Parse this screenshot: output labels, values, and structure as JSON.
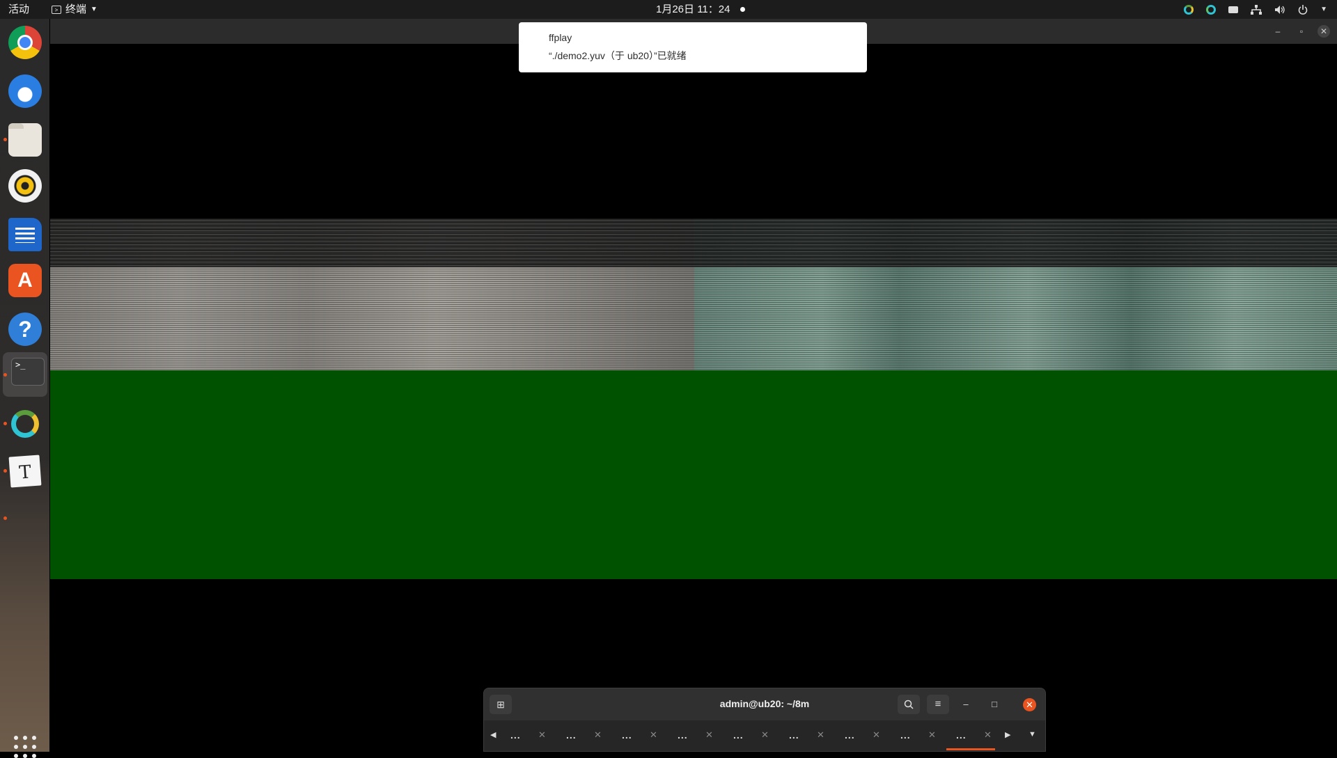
{
  "topbar": {
    "activities": "活动",
    "app_menu": "终端",
    "clock": "1月26日  11：24",
    "tray_icons": [
      "colorful-ring-icon",
      "teal-ring-icon",
      "keyboard-icon",
      "network-icon",
      "volume-icon",
      "power-icon",
      "chevron-down-icon"
    ]
  },
  "dock": {
    "items": [
      "chrome-icon",
      "thunderbird-icon",
      "files-icon",
      "rhythmbox-icon",
      "writer-icon",
      "app-store-icon",
      "help-icon",
      "terminal-icon",
      "ring-app-icon",
      "typora-icon"
    ],
    "terminal_prompt": ">_"
  },
  "notification": {
    "title": "ffplay",
    "body": "“./demo2.yuv（于 ub20）”已就绪"
  },
  "terminal": {
    "title": "admin@ub20: ~/8m",
    "tabs": [
      {
        "label": "..."
      },
      {
        "label": "..."
      },
      {
        "label": "..."
      },
      {
        "label": "..."
      },
      {
        "label": "..."
      },
      {
        "label": "..."
      },
      {
        "label": "..."
      },
      {
        "label": "..."
      },
      {
        "label": "...",
        "active": true
      }
    ]
  },
  "colors": {
    "accent": "#e95420",
    "video_green": "#005200",
    "topbar_bg": "#1c1c1c"
  }
}
